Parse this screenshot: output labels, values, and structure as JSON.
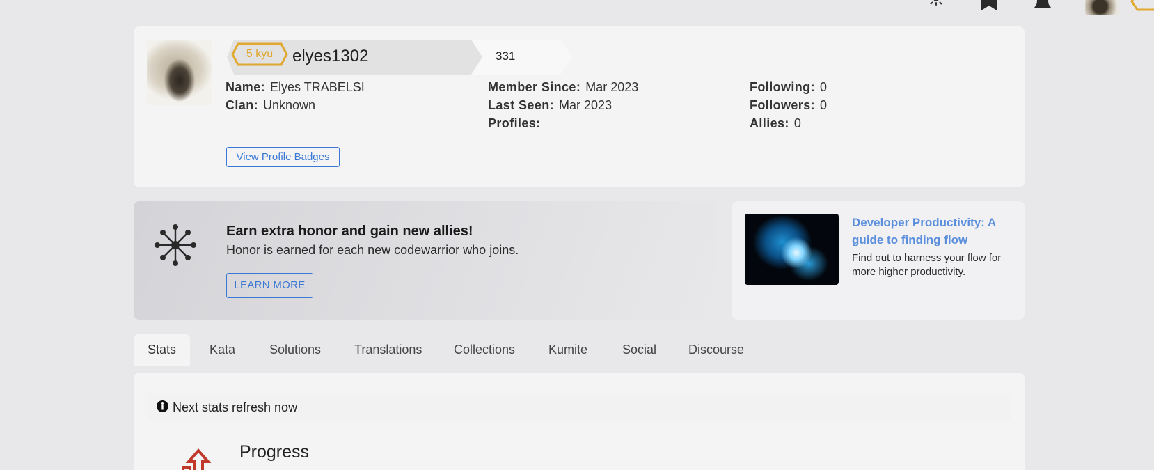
{
  "topbar": {
    "icons": [
      "sun-icon",
      "bookmark-icon",
      "bell-icon"
    ]
  },
  "profile": {
    "rank": "5 kyu",
    "username": "elyes1302",
    "honor": "331",
    "fields": {
      "name_label": "Name:",
      "name_value": "Elyes TRABELSI",
      "clan_label": "Clan:",
      "clan_value": "Unknown",
      "member_since_label": "Member Since:",
      "member_since_value": "Mar 2023",
      "last_seen_label": "Last Seen:",
      "last_seen_value": "Mar 2023",
      "profiles_label": "Profiles:",
      "following_label": "Following:",
      "following_value": "0",
      "followers_label": "Followers:",
      "followers_value": "0",
      "allies_label": "Allies:",
      "allies_value": "0"
    },
    "badges_button": "View Profile Badges"
  },
  "promo": {
    "title": "Earn extra honor and gain new allies!",
    "subtitle": "Honor is earned for each new codewarrior who joins.",
    "button": "LEARN MORE"
  },
  "article": {
    "title": "Developer Productivity: A guide to finding flow",
    "description": "Find out to harness your flow for more higher productivity."
  },
  "tabs": [
    "Stats",
    "Kata",
    "Solutions",
    "Translations",
    "Collections",
    "Kumite",
    "Social",
    "Discourse"
  ],
  "stats": {
    "refresh_text": "Next stats refresh now",
    "progress_title": "Progress"
  },
  "colors": {
    "accent_blue": "#3a78d4",
    "rank_yellow": "#e0a82e",
    "progress_red": "#c0392b"
  }
}
